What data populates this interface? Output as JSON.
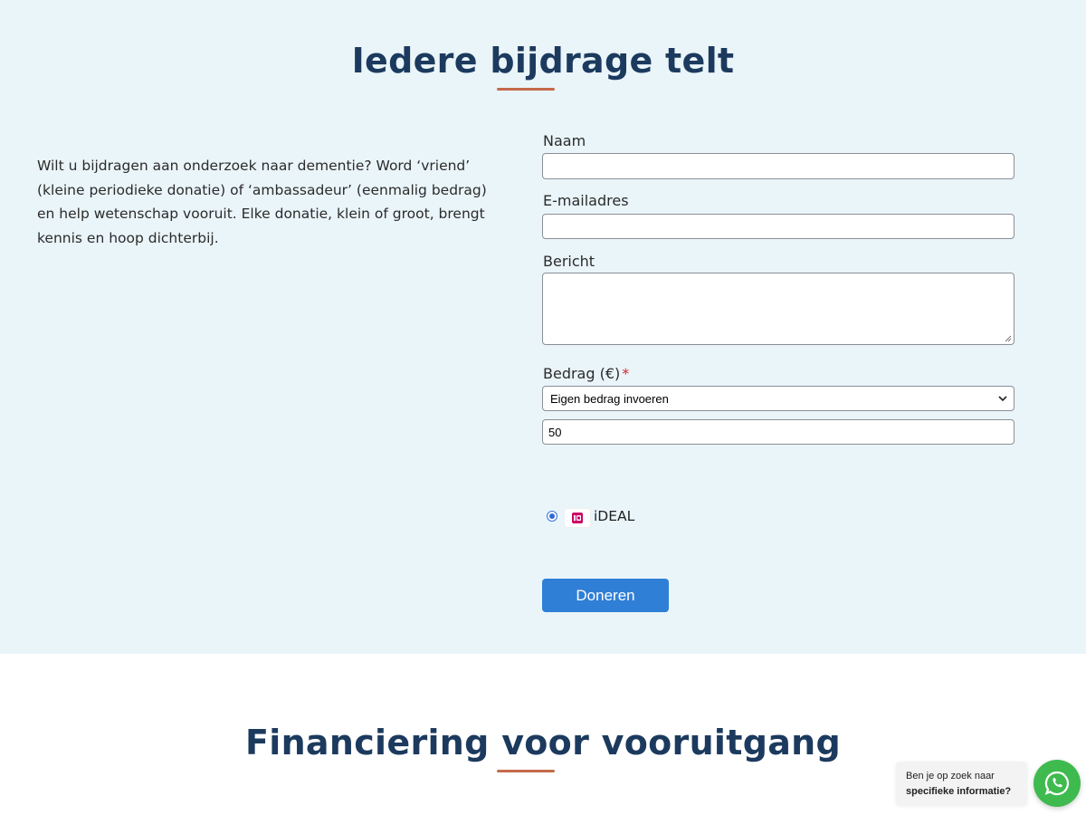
{
  "donate_section": {
    "title": "Iedere bijdrage telt",
    "intro": "Wilt u bijdragen aan onderzoek naar dementie? Word ‘vriend’ (kleine periodieke donatie) of ‘ambassadeur’ (eenmalig bedrag) en help wetenschap vooruit. Elke donatie, klein of groot, brengt kennis en hoop dichterbij.",
    "form": {
      "name_label": "Naam",
      "name_value": "",
      "email_label": "E-mailadres",
      "email_value": "",
      "message_label": "Bericht",
      "message_value": "",
      "amount_label": "Bedrag (€)",
      "required_mark": "*",
      "amount_select_value": "Eigen bedrag invoeren",
      "amount_value": "50",
      "payment_method_label": "iDEAL",
      "payment_method_selected": true,
      "submit_label": "Doneren"
    }
  },
  "financing_section": {
    "title": "Financiering voor vooruitgang"
  },
  "chat_widget": {
    "line1": "Ben je op zoek naar",
    "line2": "specifieke informatie?"
  },
  "colors": {
    "section_bg": "#eaf5f9",
    "title": "#1c3a5e",
    "accent_underline": "#c46a4a",
    "button": "#2f7fd6",
    "whatsapp": "#3fba4f",
    "ideal_brand": "#cc0066"
  },
  "icons": {
    "select": "chevron-down-icon",
    "payment": "ideal-logo",
    "chat": "whatsapp-icon"
  }
}
